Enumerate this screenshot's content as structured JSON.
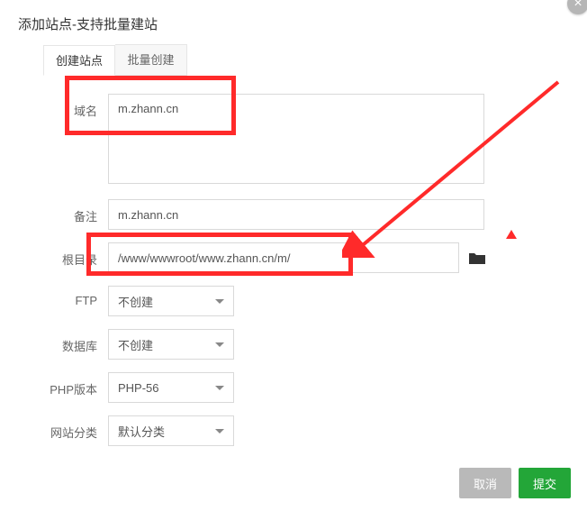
{
  "dialog": {
    "title": "添加站点-支持批量建站"
  },
  "tabs": {
    "create": "创建站点",
    "batch": "批量创建"
  },
  "labels": {
    "domain": "域名",
    "remark": "备注",
    "rootdir": "根目录",
    "ftp": "FTP",
    "database": "数据库",
    "php": "PHP版本",
    "category": "网站分类"
  },
  "values": {
    "domain": "m.zhann.cn",
    "remark": "m.zhann.cn",
    "rootdir": "/www/wwwroot/www.zhann.cn/m/",
    "ftp": "不创建",
    "database": "不创建",
    "php": "PHP-56",
    "category": "默认分类"
  },
  "buttons": {
    "cancel": "取消",
    "submit": "提交"
  },
  "icons": {
    "close": "×"
  }
}
